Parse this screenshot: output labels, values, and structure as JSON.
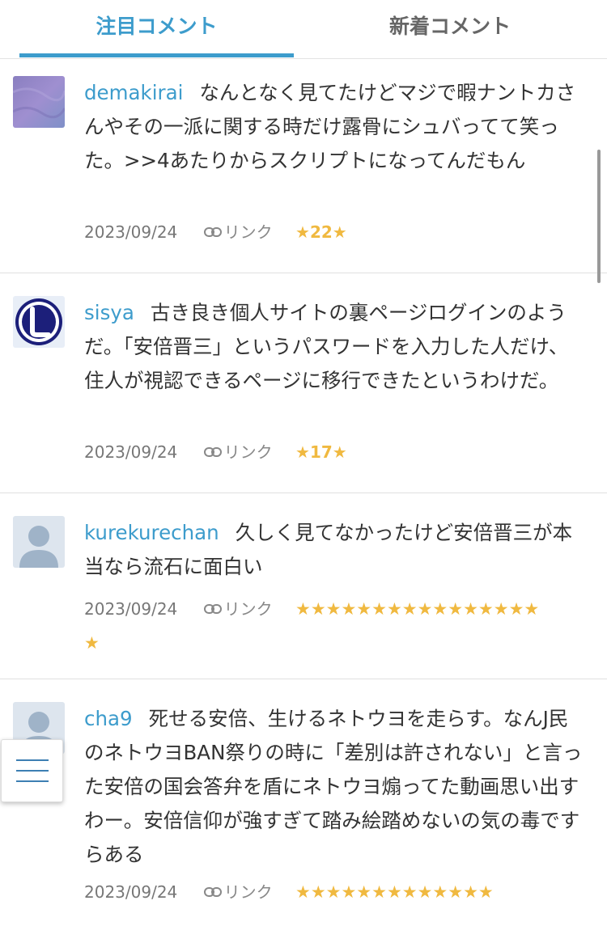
{
  "tabs": [
    {
      "label": "注目コメント",
      "active": true
    },
    {
      "label": "新着コメント",
      "active": false
    }
  ],
  "comments": [
    {
      "username": "demakirai",
      "text": "なんとなく見てたけどマジで暇ナントカさんやその一派に関する時だけ露骨にシュバってて笑った。>>4あたりからスクリプトになってんだもん",
      "date": "2023/09/24",
      "link_label": "リンク",
      "stars_before": "★",
      "star_count": "22",
      "stars_after": "★",
      "avatar": "purple-gradient"
    },
    {
      "username": "sisya",
      "text": "古き良き個人サイトの裏ページログインのようだ。「安倍晋三」というパスワードを入力した人だけ、住人が視認できるページに移行できたというわけだ。",
      "date": "2023/09/24",
      "link_label": "リンク",
      "stars_before": "★",
      "star_count": "17",
      "stars_after": "★",
      "avatar": "letter-L-circle"
    },
    {
      "username": "kurekurechan",
      "text": "久しく見てなかったけど安倍晋三が本当なら流石に面白い",
      "date": "2023/09/24",
      "link_label": "リンク",
      "stars_line1": "★★★★★★★★★★★★★★★★",
      "stars_line2": "★",
      "avatar": "default-person"
    },
    {
      "username": "cha9",
      "text": "死せる安倍、生けるネトウヨを走らす。なんJ民のネトウヨBAN祭りの時に「差別は許されない」と言った安倍の国会答弁を盾にネトウヨ煽ってた動画思い出すわー。安倍信仰が強すぎて踏み絵踏めないの気の毒ですらある",
      "date": "2023/09/24",
      "link_label": "リンク",
      "stars_line1": "★★★★★★★★★★★★★",
      "avatar": "default-person"
    }
  ],
  "colors": {
    "accent": "#3d9ccc",
    "star": "#f0b940",
    "text": "#333333",
    "meta": "#777777"
  }
}
